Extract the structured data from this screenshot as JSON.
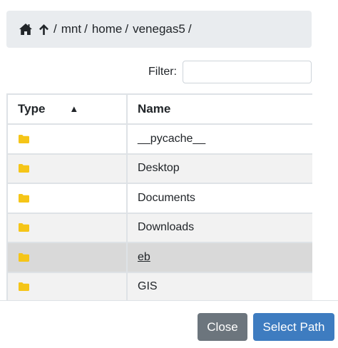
{
  "breadcrumb": {
    "home_icon": "home-icon",
    "up_icon": "arrow-up-icon",
    "separator": "/",
    "segments": [
      "mnt",
      "home",
      "venegas5"
    ]
  },
  "filter": {
    "label": "Filter:",
    "value": "",
    "placeholder": ""
  },
  "table": {
    "columns": [
      {
        "label": "Type",
        "sort": "ascending",
        "sort_glyph": "▲"
      },
      {
        "label": "Name"
      }
    ],
    "rows": [
      {
        "type_icon": "folder-icon",
        "name": "__pycache__"
      },
      {
        "type_icon": "folder-icon",
        "name": "Desktop"
      },
      {
        "type_icon": "folder-icon",
        "name": "Documents"
      },
      {
        "type_icon": "folder-icon",
        "name": "Downloads"
      },
      {
        "type_icon": "folder-icon",
        "name": "eb",
        "selected": true
      },
      {
        "type_icon": "folder-icon",
        "name": "GIS"
      }
    ]
  },
  "footer": {
    "close_label": "Close",
    "select_label": "Select Path"
  },
  "colors": {
    "folder": "#f5c518",
    "breadcrumb_bg": "#e9ecef",
    "close_button": "#6c757d",
    "select_button": "#3e7cc0",
    "selected_row": "#d9d9d9"
  }
}
